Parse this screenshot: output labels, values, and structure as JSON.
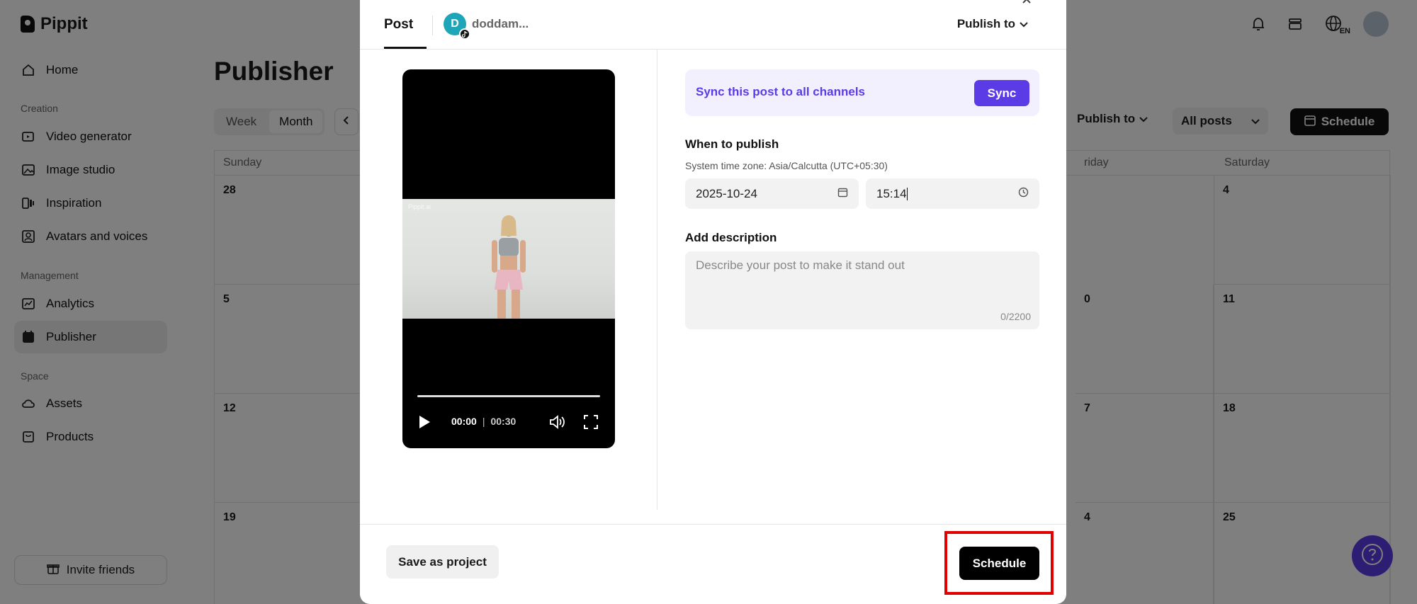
{
  "app": {
    "name": "Pippit"
  },
  "sidebar": {
    "items": [
      {
        "label": "Home",
        "icon": "home-icon"
      },
      {
        "label": "Video generator",
        "icon": "video-icon"
      },
      {
        "label": "Image studio",
        "icon": "image-icon"
      },
      {
        "label": "Inspiration",
        "icon": "inspiration-icon"
      },
      {
        "label": "Avatars and voices",
        "icon": "avatar-icon"
      },
      {
        "label": "Analytics",
        "icon": "analytics-icon"
      },
      {
        "label": "Publisher",
        "icon": "calendar-icon"
      },
      {
        "label": "Assets",
        "icon": "cloud-icon"
      },
      {
        "label": "Products",
        "icon": "bag-icon"
      }
    ],
    "sections": [
      "Creation",
      "Management",
      "Space"
    ],
    "invite_label": "Invite friends"
  },
  "header": {
    "language": "EN"
  },
  "publisher": {
    "title": "Publisher",
    "views": [
      "Week",
      "Month"
    ],
    "publish_to": "Publish to",
    "filter": "All posts",
    "schedule_label": "Schedule",
    "weekdays": [
      "Sunday",
      "riday",
      "Saturday"
    ],
    "days": [
      "28",
      "4",
      "5",
      "0",
      "11",
      "12",
      "7",
      "18",
      "19",
      "4",
      "25"
    ]
  },
  "modal": {
    "tab_post": "Post",
    "channel_initial": "D",
    "channel_name": "doddam...",
    "publish_to": "Publish to",
    "video": {
      "watermark": "Pippit.ai",
      "current_time": "00:00",
      "separator": "|",
      "duration": "00:30",
      "progress": 0
    },
    "sync": {
      "text": "Sync this post to all channels",
      "button": "Sync"
    },
    "when_label": "When to publish",
    "timezone": "System time zone: Asia/Calcutta (UTC+05:30)",
    "date_value": "2025-10-24",
    "time_value": "15:14",
    "description_label": "Add description",
    "description_placeholder": "Describe your post to make it stand out",
    "char_count": "0/2200",
    "save_label": "Save as project",
    "schedule_label": "Schedule"
  },
  "colors": {
    "accent": "#5b3be6",
    "highlight": "#e00000",
    "primary_button": "#000000"
  }
}
